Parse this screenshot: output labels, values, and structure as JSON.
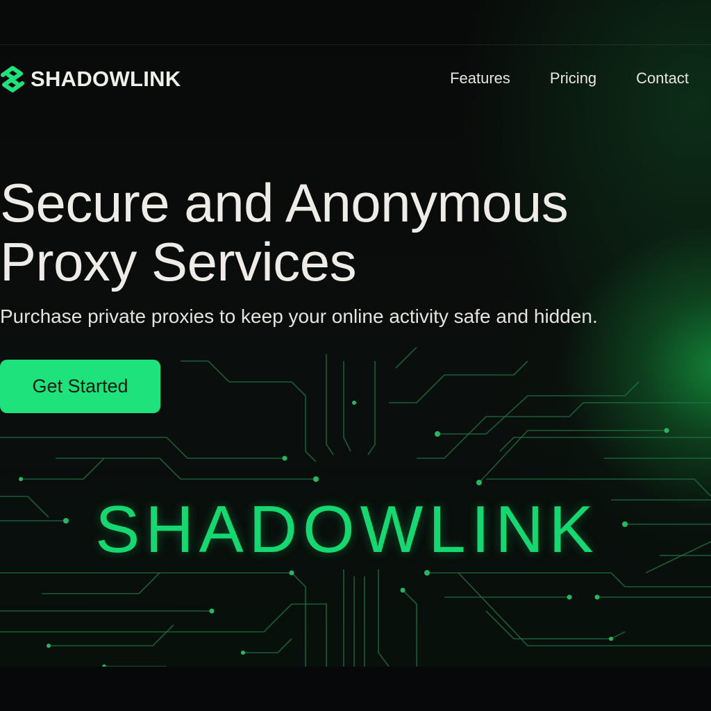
{
  "brand": {
    "name": "SHADOWLINK",
    "accent": "#1ee37c",
    "icon": "chain-link-logo-icon"
  },
  "nav": {
    "links": [
      {
        "label": "Features"
      },
      {
        "label": "Pricing"
      },
      {
        "label": "Contact"
      }
    ]
  },
  "hero": {
    "title_line1": "Secure and Anonymous",
    "title_line2": "Proxy Services",
    "subtitle": "Purchase private proxies to keep your online activity safe and hidden.",
    "cta_label": "Get Started"
  },
  "banner": {
    "wordmark": "SHADOWLINK",
    "glow_color": "#14d870"
  }
}
